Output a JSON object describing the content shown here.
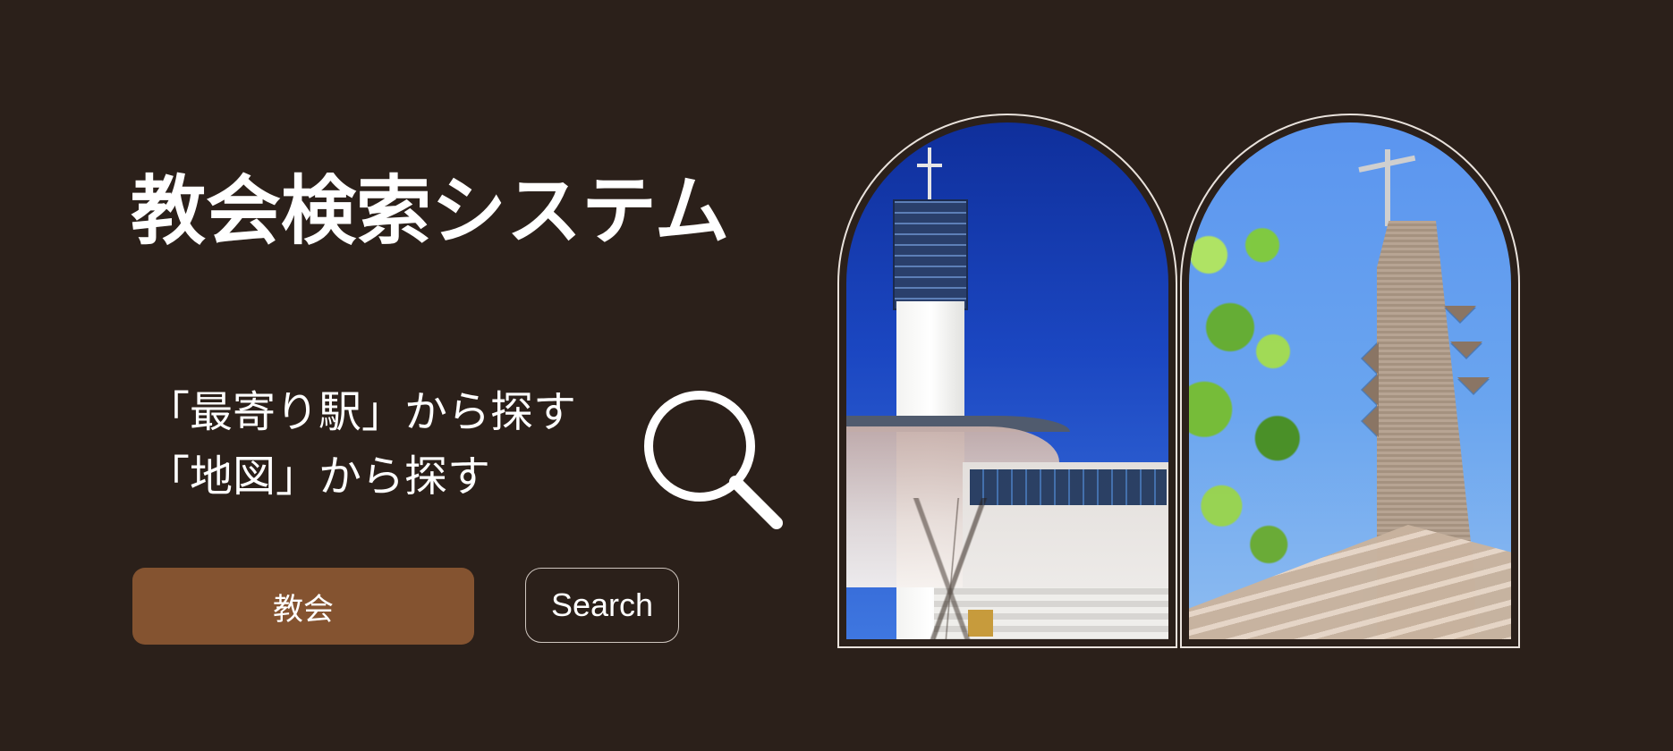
{
  "page": {
    "title": "教会検索システム",
    "lines": [
      "「最寄り駅」から探す",
      "「地図」から探す"
    ],
    "buttons": {
      "primary": "教会",
      "secondary": "Search"
    }
  },
  "icons": {
    "search": "search-icon",
    "images": [
      "church-photo-left",
      "church-photo-right"
    ]
  },
  "colors": {
    "background": "#2b201a",
    "primary_button": "#845330",
    "panel_border": "#e9e2dc"
  }
}
